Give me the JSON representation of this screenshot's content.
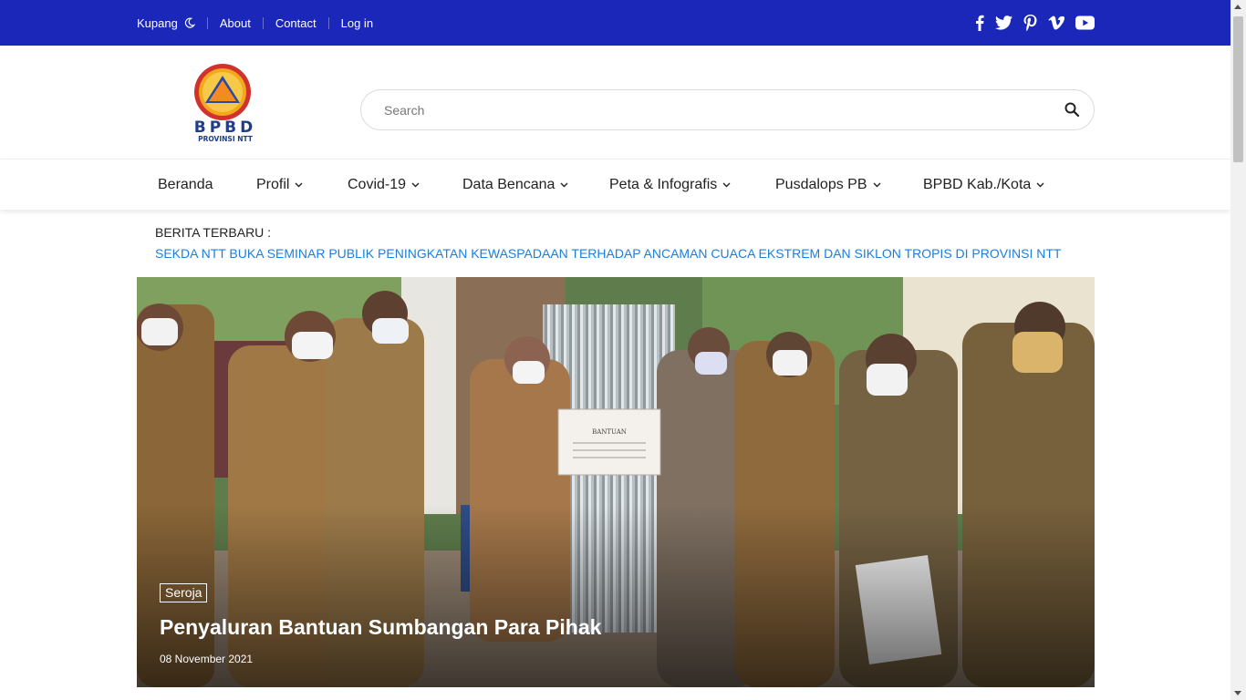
{
  "topbar": {
    "location": "Kupang",
    "links": [
      "About",
      "Contact",
      "Log in"
    ],
    "social_icons": [
      "facebook-icon",
      "twitter-icon",
      "pinterest-icon",
      "vimeo-icon",
      "youtube-icon"
    ],
    "background": "#1b27b8"
  },
  "header": {
    "logo_text": "BPBD",
    "logo_subtext": "PROVINSI NTT",
    "search_placeholder": "Search"
  },
  "nav": {
    "items": [
      "Beranda",
      "Profil",
      "Covid-19",
      "Data Bencana",
      "Peta & Infografis",
      "Pusdalops PB",
      "BPBD Kab./Kota"
    ]
  },
  "news": {
    "label": "BERITA TERBARU :",
    "headline": "SEKDA NTT BUKA SEMINAR PUBLIK PENINGKATAN KEWASPADAAN TERHADAP ANCAMAN CUACA EKSTREM DAN SIKLON TROPIS DI PROVINSI NTT",
    "link_color": "#1a7fe0"
  },
  "hero": {
    "category": "Seroja",
    "title": "Penyaluran Bantuan Sumbangan Para Pihak",
    "date": "08 November 2021",
    "board_text": "BANTUAN"
  }
}
